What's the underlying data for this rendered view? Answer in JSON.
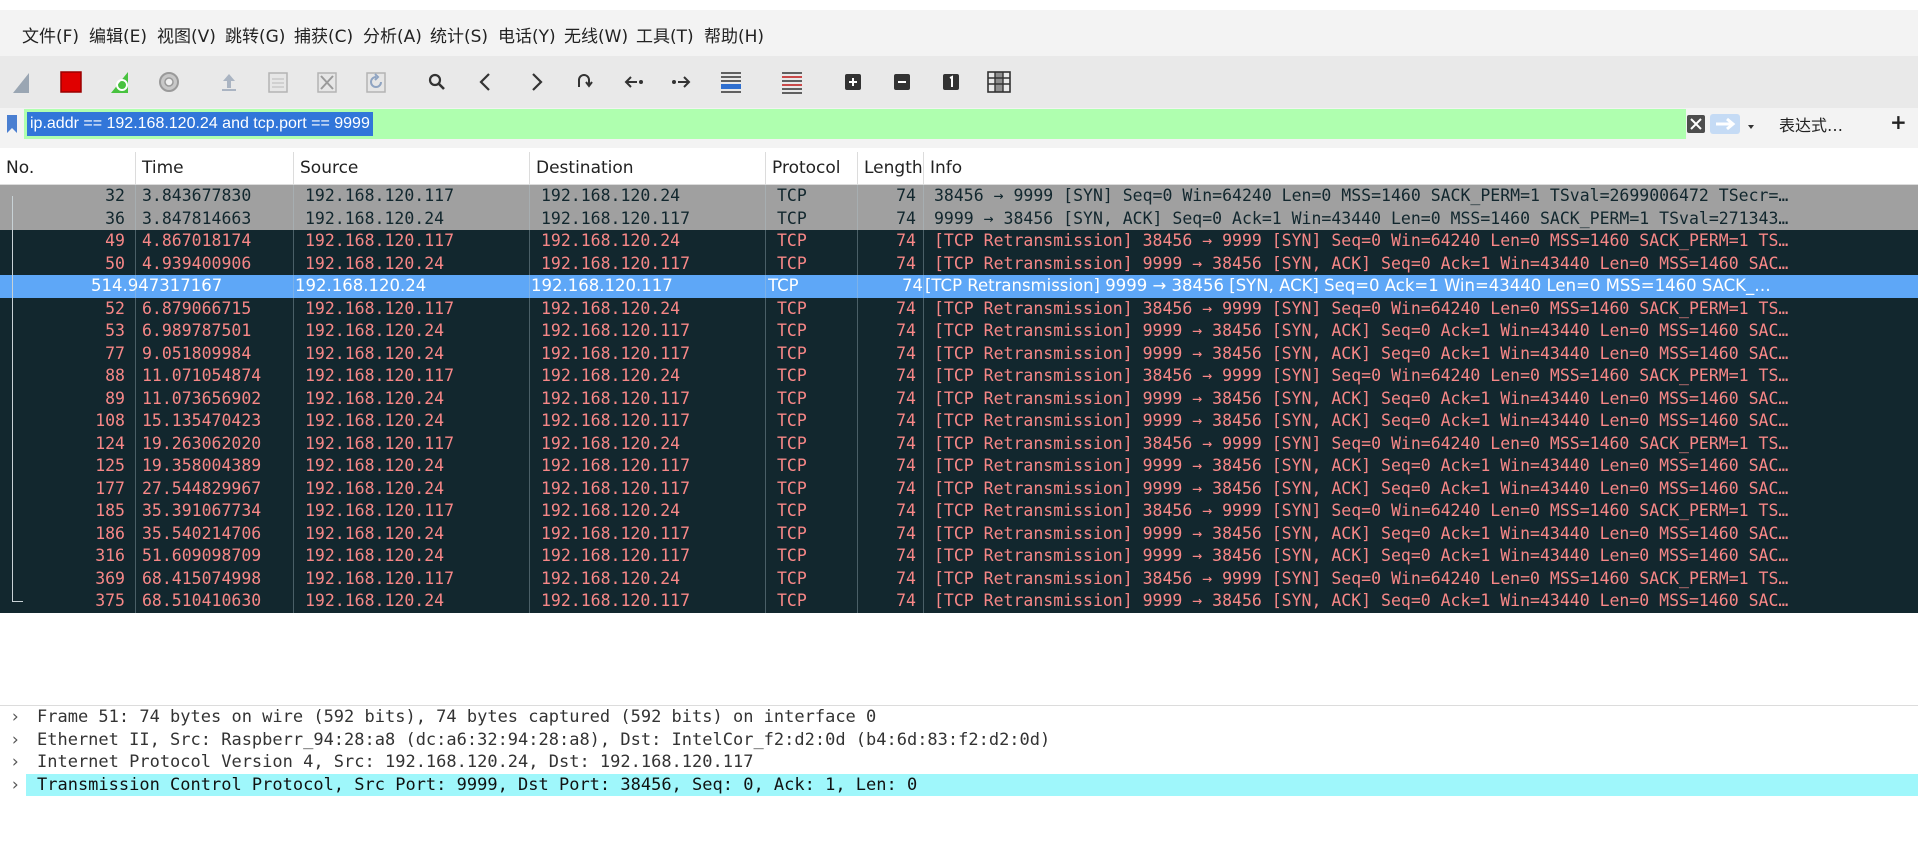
{
  "menu": [
    "文件(F)",
    "编辑(E)",
    "视图(V)",
    "跳转(G)",
    "捕获(C)",
    "分析(A)",
    "统计(S)",
    "电话(Y)",
    "无线(W)",
    "工具(T)",
    "帮助(H)"
  ],
  "toolbar": {
    "icons": [
      "shark-fin-icon",
      "stop-capture-icon",
      "restart-capture-icon",
      "capture-options-icon",
      "open-file-icon",
      "save-file-icon",
      "close-file-icon",
      "reload-file-icon",
      "find-packet-icon",
      "go-back-icon",
      "go-forward-icon",
      "go-to-packet-icon",
      "go-first-packet-icon",
      "go-last-packet-icon",
      "auto-scroll-icon",
      "colorize-icon",
      "zoom-in-icon",
      "zoom-out-icon",
      "normal-size-icon",
      "resize-columns-icon"
    ]
  },
  "filter": {
    "value": "ip.addr == 192.168.120.24 and tcp.port == 9999",
    "expression_label": "表达式…",
    "add_label": "+",
    "clear_icon": "clear-filter-icon",
    "apply_icon": "apply-filter-icon",
    "bookmark_icon": "bookmark-icon",
    "dropdown_icon": "chevron-down-icon"
  },
  "columns": [
    "No.",
    "Time",
    "Source",
    "Destination",
    "Protocol",
    "Length",
    "Info"
  ],
  "packets": [
    {
      "no": "32",
      "time": "3.843677830",
      "src": "192.168.120.117",
      "dst": "192.168.120.24",
      "proto": "TCP",
      "len": "74",
      "info": "38456 → 9999 [SYN] Seq=0 Win=64240 Len=0 MSS=1460 SACK_PERM=1 TSval=2699006472 TSecr=…"
    },
    {
      "no": "36",
      "time": "3.847814663",
      "src": "192.168.120.24",
      "dst": "192.168.120.117",
      "proto": "TCP",
      "len": "74",
      "info": "9999 → 38456 [SYN, ACK] Seq=0 Ack=1 Win=43440 Len=0 MSS=1460 SACK_PERM=1 TSval=271343…"
    },
    {
      "no": "49",
      "time": "4.867018174",
      "src": "192.168.120.117",
      "dst": "192.168.120.24",
      "proto": "TCP",
      "len": "74",
      "info": "[TCP Retransmission] 38456 → 9999 [SYN] Seq=0 Win=64240 Len=0 MSS=1460 SACK_PERM=1 TS…"
    },
    {
      "no": "50",
      "time": "4.939400906",
      "src": "192.168.120.24",
      "dst": "192.168.120.117",
      "proto": "TCP",
      "len": "74",
      "info": "[TCP Retransmission] 9999 → 38456 [SYN, ACK] Seq=0 Ack=1 Win=43440 Len=0 MSS=1460 SAC…"
    },
    {
      "no": "51",
      "time": "4.947317167",
      "src": "192.168.120.24",
      "dst": "192.168.120.117",
      "proto": "TCP",
      "len": "74",
      "info": "[TCP Retransmission] 9999 → 38456 [SYN, ACK] Seq=0 Ack=1 Win=43440 Len=0 MSS=1460 SACK_…"
    },
    {
      "no": "52",
      "time": "6.879066715",
      "src": "192.168.120.117",
      "dst": "192.168.120.24",
      "proto": "TCP",
      "len": "74",
      "info": "[TCP Retransmission] 38456 → 9999 [SYN] Seq=0 Win=64240 Len=0 MSS=1460 SACK_PERM=1 TS…"
    },
    {
      "no": "53",
      "time": "6.989787501",
      "src": "192.168.120.24",
      "dst": "192.168.120.117",
      "proto": "TCP",
      "len": "74",
      "info": "[TCP Retransmission] 9999 → 38456 [SYN, ACK] Seq=0 Ack=1 Win=43440 Len=0 MSS=1460 SAC…"
    },
    {
      "no": "77",
      "time": "9.051809984",
      "src": "192.168.120.24",
      "dst": "192.168.120.117",
      "proto": "TCP",
      "len": "74",
      "info": "[TCP Retransmission] 9999 → 38456 [SYN, ACK] Seq=0 Ack=1 Win=43440 Len=0 MSS=1460 SAC…"
    },
    {
      "no": "88",
      "time": "11.071054874",
      "src": "192.168.120.117",
      "dst": "192.168.120.24",
      "proto": "TCP",
      "len": "74",
      "info": "[TCP Retransmission] 38456 → 9999 [SYN] Seq=0 Win=64240 Len=0 MSS=1460 SACK_PERM=1 TS…"
    },
    {
      "no": "89",
      "time": "11.073656902",
      "src": "192.168.120.24",
      "dst": "192.168.120.117",
      "proto": "TCP",
      "len": "74",
      "info": "[TCP Retransmission] 9999 → 38456 [SYN, ACK] Seq=0 Ack=1 Win=43440 Len=0 MSS=1460 SAC…"
    },
    {
      "no": "108",
      "time": "15.135470423",
      "src": "192.168.120.24",
      "dst": "192.168.120.117",
      "proto": "TCP",
      "len": "74",
      "info": "[TCP Retransmission] 9999 → 38456 [SYN, ACK] Seq=0 Ack=1 Win=43440 Len=0 MSS=1460 SAC…"
    },
    {
      "no": "124",
      "time": "19.263062020",
      "src": "192.168.120.117",
      "dst": "192.168.120.24",
      "proto": "TCP",
      "len": "74",
      "info": "[TCP Retransmission] 38456 → 9999 [SYN] Seq=0 Win=64240 Len=0 MSS=1460 SACK_PERM=1 TS…"
    },
    {
      "no": "125",
      "time": "19.358004389",
      "src": "192.168.120.24",
      "dst": "192.168.120.117",
      "proto": "TCP",
      "len": "74",
      "info": "[TCP Retransmission] 9999 → 38456 [SYN, ACK] Seq=0 Ack=1 Win=43440 Len=0 MSS=1460 SAC…"
    },
    {
      "no": "177",
      "time": "27.544829967",
      "src": "192.168.120.24",
      "dst": "192.168.120.117",
      "proto": "TCP",
      "len": "74",
      "info": "[TCP Retransmission] 9999 → 38456 [SYN, ACK] Seq=0 Ack=1 Win=43440 Len=0 MSS=1460 SAC…"
    },
    {
      "no": "185",
      "time": "35.391067734",
      "src": "192.168.120.117",
      "dst": "192.168.120.24",
      "proto": "TCP",
      "len": "74",
      "info": "[TCP Retransmission] 38456 → 9999 [SYN] Seq=0 Win=64240 Len=0 MSS=1460 SACK_PERM=1 TS…"
    },
    {
      "no": "186",
      "time": "35.540214706",
      "src": "192.168.120.24",
      "dst": "192.168.120.117",
      "proto": "TCP",
      "len": "74",
      "info": "[TCP Retransmission] 9999 → 38456 [SYN, ACK] Seq=0 Ack=1 Win=43440 Len=0 MSS=1460 SAC…"
    },
    {
      "no": "316",
      "time": "51.609098709",
      "src": "192.168.120.24",
      "dst": "192.168.120.117",
      "proto": "TCP",
      "len": "74",
      "info": "[TCP Retransmission] 9999 → 38456 [SYN, ACK] Seq=0 Ack=1 Win=43440 Len=0 MSS=1460 SAC…"
    },
    {
      "no": "369",
      "time": "68.415074998",
      "src": "192.168.120.117",
      "dst": "192.168.120.24",
      "proto": "TCP",
      "len": "74",
      "info": "[TCP Retransmission] 38456 → 9999 [SYN] Seq=0 Win=64240 Len=0 MSS=1460 SACK_PERM=1 TS…"
    },
    {
      "no": "375",
      "time": "68.510410630",
      "src": "192.168.120.24",
      "dst": "192.168.120.117",
      "proto": "TCP",
      "len": "74",
      "info": "[TCP Retransmission] 9999 → 38456 [SYN, ACK] Seq=0 Ack=1 Win=43440 Len=0 MSS=1460 SAC…"
    }
  ],
  "selected_packet": "51",
  "row_colors": {
    "normal_bg": "#a0a0a0",
    "normal_fg": "#12272e",
    "retrans_bg": "#12272e",
    "retrans_fg": "#f78787",
    "selected_bg": "#5ea7f7",
    "selected_fg": "#ffffff"
  },
  "details": [
    "Frame 51: 74 bytes on wire (592 bits), 74 bytes captured (592 bits) on interface 0",
    "Ethernet II, Src: Raspberr_94:28:a8 (dc:a6:32:94:28:a8), Dst: IntelCor_f2:d2:0d (b4:6d:83:f2:d2:0d)",
    "Internet Protocol Version 4, Src: 192.168.120.24, Dst: 192.168.120.117",
    "Transmission Control Protocol, Src Port: 9999, Dst Port: 38456, Seq: 0, Ack: 1, Len: 0"
  ],
  "details_chevron": "›",
  "active_detail": 3
}
